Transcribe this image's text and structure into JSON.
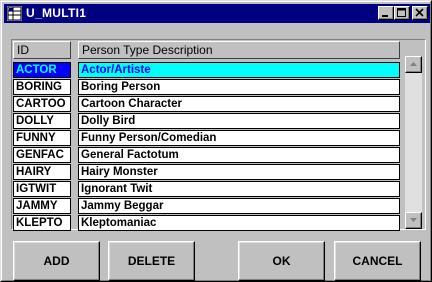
{
  "window": {
    "title": "U_MULTI1",
    "minimize_icon": "minimize-icon",
    "maximize_icon": "maximize-icon",
    "close_icon": "close-icon"
  },
  "grid": {
    "columns": [
      "ID",
      "Person Type Description"
    ],
    "rows": [
      {
        "id": "ACTOR",
        "description": "Actor/Artiste",
        "selected": true
      },
      {
        "id": "BORING",
        "description": "Boring Person"
      },
      {
        "id": "CARTOO",
        "description": "Cartoon Character"
      },
      {
        "id": "DOLLY",
        "description": "Dolly Bird"
      },
      {
        "id": "FUNNY",
        "description": "Funny Person/Comedian"
      },
      {
        "id": "GENFAC",
        "description": "General Factotum"
      },
      {
        "id": "HAIRY",
        "description": "Hairy Monster"
      },
      {
        "id": "IGTWIT",
        "description": "Ignorant Twit"
      },
      {
        "id": "JAMMY",
        "description": "Jammy Beggar"
      },
      {
        "id": "KLEPTO",
        "description": "Kleptomaniac"
      }
    ],
    "selection_colors": {
      "id_bg": "#0000ff",
      "id_fg": "#00ffff",
      "desc_bg": "#00ffff",
      "desc_fg": "#0000ff"
    }
  },
  "buttons": {
    "add": "ADD",
    "delete": "DELETE",
    "ok": "OK",
    "cancel": "CANCEL"
  }
}
